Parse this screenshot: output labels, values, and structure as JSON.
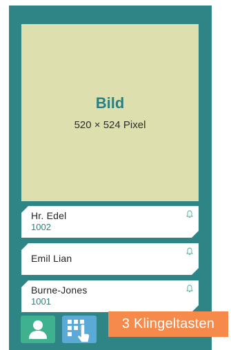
{
  "screen": {
    "image_placeholder": {
      "title": "Bild",
      "subtitle": "520 × 524 Pixel"
    },
    "bell_buttons": [
      {
        "name": "Hr. Edel",
        "number": "1002",
        "icon": "bell-icon"
      },
      {
        "name": "Emil Lian",
        "number": "",
        "icon": "bell-icon"
      },
      {
        "name": "Burne-Jones",
        "number": "1001",
        "icon": "bell-icon"
      }
    ],
    "bottom_bar": {
      "contacts_icon": "person-icon",
      "keypad_icon": "keypad-touch-icon"
    }
  },
  "annotation": {
    "label": "3 Klingeltasten"
  },
  "colors": {
    "device_background": "#2f8585",
    "image_placeholder": "#dedfae",
    "accent_teal": "#2b7f80",
    "contacts_button": "#3fb18f",
    "keypad_button": "#5aa9d6",
    "callout": "#f58a4a"
  }
}
